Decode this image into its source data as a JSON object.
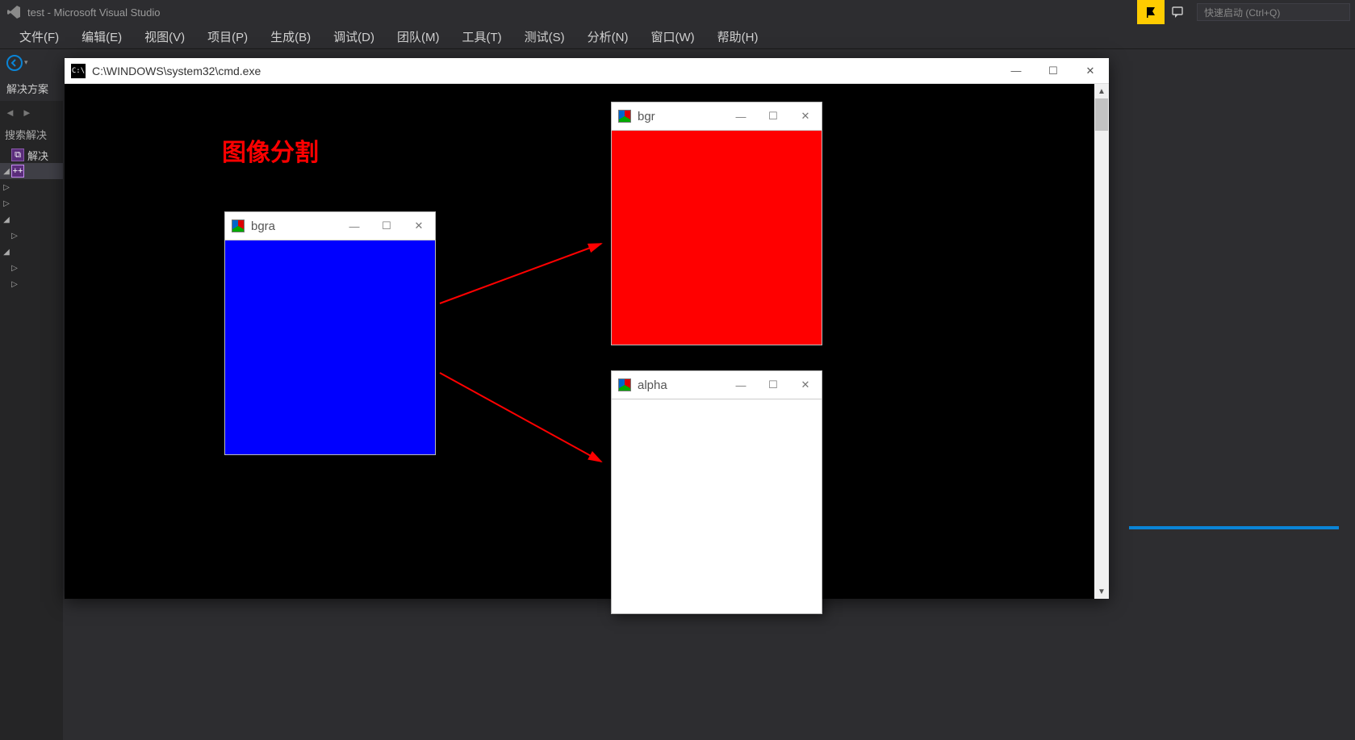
{
  "app": {
    "title": "test - Microsoft Visual Studio",
    "quick_launch_placeholder": "快速启动 (Ctrl+Q)"
  },
  "menu": {
    "file": "文件(F)",
    "edit": "编辑(E)",
    "view": "视图(V)",
    "project": "项目(P)",
    "build": "生成(B)",
    "debug": "调试(D)",
    "team": "团队(M)",
    "tools": "工具(T)",
    "test": "测试(S)",
    "analyze": "分析(N)",
    "window": "窗口(W)",
    "help": "帮助(H)"
  },
  "sidebar": {
    "title": "解决方案",
    "search": "搜索解决",
    "solution_label": "解决"
  },
  "cmd": {
    "title": "C:\\WINDOWS\\system32\\cmd.exe",
    "icon_text": "C:\\"
  },
  "annotation": {
    "heading": "图像分割"
  },
  "cv": {
    "bgra": {
      "title": "bgra",
      "color_hex": "#0000ff"
    },
    "bgr": {
      "title": "bgr",
      "color_hex": "#ff0000"
    },
    "alpha": {
      "title": "alpha",
      "color_hex": "#ffffff"
    }
  }
}
